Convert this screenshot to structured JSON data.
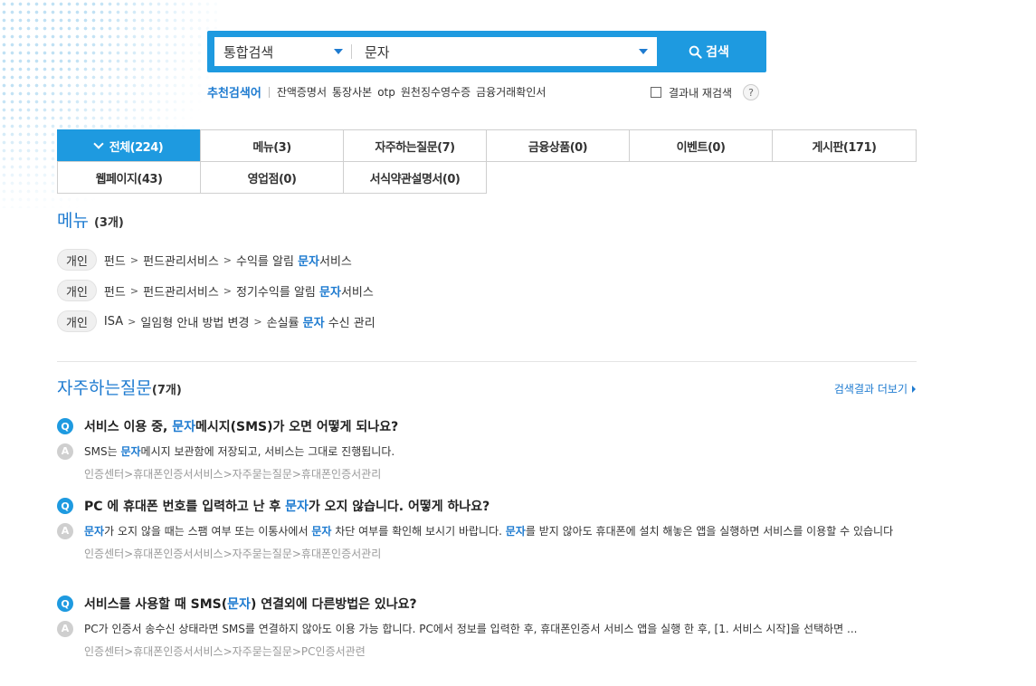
{
  "search": {
    "category": "통합검색",
    "query": "문자",
    "button_label": "검색"
  },
  "recommend": {
    "title": "추천검색어",
    "keywords": [
      "잔액증명서",
      "통장사본",
      "otp",
      "원천징수영수증",
      "금융거래확인서"
    ],
    "research_label": "결과내 재검색",
    "help_label": "?"
  },
  "tabs": [
    {
      "label": "전체(224)",
      "active": true
    },
    {
      "label": "메뉴(3)"
    },
    {
      "label": "자주하는질문(7)"
    },
    {
      "label": "금융상품(0)"
    },
    {
      "label": "이벤트(0)"
    },
    {
      "label": "게시판(171)"
    },
    {
      "label": "웹페이지(43)"
    },
    {
      "label": "영업점(0)"
    },
    {
      "label": "서식약관설명서(0)"
    }
  ],
  "menu_section": {
    "title": "메뉴",
    "count": "(3개)",
    "rows": [
      {
        "tag": "개인",
        "parts": [
          "펀드",
          "펀드관리서비스",
          "수익를 알림 "
        ],
        "hl": "문자",
        "tail": "서비스"
      },
      {
        "tag": "개인",
        "parts": [
          "펀드",
          "펀드관리서비스",
          "정기수익를 알림 "
        ],
        "hl": "문자",
        "tail": "서비스"
      },
      {
        "tag": "개인",
        "parts": [
          "ISA",
          "일임형 안내 방법 변경",
          "손실률 "
        ],
        "hl": "문자",
        "tail": " 수신 관리"
      }
    ]
  },
  "faq_section": {
    "title": "자주하는질문",
    "count": "(7개)",
    "more_label": "검색결과 더보기",
    "q_badge": "Q",
    "a_badge": "A",
    "items": [
      {
        "q_pre": "서비스 이용 중, ",
        "q_hl": "문자",
        "q_post": "메시지(SMS)가 오면 어떻게 되나요?",
        "a_html": [
          "SMS는 ",
          "문자",
          "메시지 보관함에 저장되고, 서비스는 그대로 진행됩니다."
        ],
        "path": "인증센터>휴대폰인증서서비스>자주묻는질문>휴대폰인증서관리"
      },
      {
        "q_pre": "PC 에 휴대폰 번호를 입력하고 난 후 ",
        "q_hl": "문자",
        "q_post": "가 오지 않습니다. 어떻게 하나요?",
        "a_html": [
          "",
          "문자",
          "가 오지 않을 때는 스팸 여부 또는 이통사에서 ",
          "문자",
          " 차단 여부를 확인해 보시기 바랍니다. ",
          "문자",
          "를 받지 않아도 휴대폰에 설치 해놓은 앱을 실행하면 서비스를 이용할 수 있습니다"
        ],
        "path": "인증센터>휴대폰인증서서비스>자주묻는질문>휴대폰인증서관리"
      },
      {
        "q_pre": "서비스를 사용할 때 SMS(",
        "q_hl": "문자",
        "q_post": ") 연결외에 다른방법은 있나요?",
        "a_html": [
          "PC가 인증서 송수신 상태라면 SMS를 연결하지 않아도 이용 가능 합니다. PC에서 정보를 입력한 후, 휴대폰인증서 서비스 앱을 실행 한 후, [1. 서비스 시작]을 선택하면 ..."
        ],
        "path": "인증센터>휴대폰인증서서비스>자주묻는질문>PC인증서관련"
      }
    ]
  }
}
